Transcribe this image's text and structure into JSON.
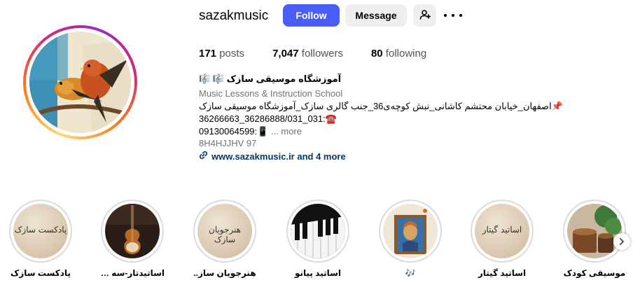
{
  "profile": {
    "username": "sazakmusic",
    "follow_label": "Follow",
    "message_label": "Message",
    "stats": {
      "posts_count": "171",
      "posts_label": "posts",
      "followers_count": "7,047",
      "followers_label": "followers",
      "following_count": "80",
      "following_label": "following"
    }
  },
  "bio": {
    "name": "آموزشگاه موسیقی سازک 🎼 🎼",
    "category": "Music Lessons & Instruction School",
    "line1": "📌اصفهان_خیابان محتشم کاشانی_نبش کوچه‌ی36_جنب گالری سازک_آموزشگاه موسیقی سازک",
    "line2": "36266663_36286888/031_031:☎️",
    "line3": "09130064599:📱",
    "more_label": "... more",
    "code": "8H4HJJHV 97",
    "link": "www.sazakmusic.ir and 4 more"
  },
  "highlights": [
    {
      "label": "پادکست سازک",
      "art": "پادکست سازک"
    },
    {
      "label": "اساتیدتار-سه تار",
      "art": ""
    },
    {
      "label": "هنرجویان ساز..",
      "art": "هنرجویان سازک"
    },
    {
      "label": "اساتید پیانو",
      "art": ""
    },
    {
      "label": "🎶",
      "art": ""
    },
    {
      "label": "اساتید گیتار",
      "art": "اساتید گیتار"
    },
    {
      "label": "موسیقی کودک",
      "art": ""
    }
  ],
  "colors": {
    "follow_button": "#4a5df9",
    "link": "#00376b",
    "secondary_text": "#737373"
  },
  "icons": [
    "add-user-icon",
    "more-options-icon",
    "link-icon",
    "chevron-right-icon"
  ]
}
